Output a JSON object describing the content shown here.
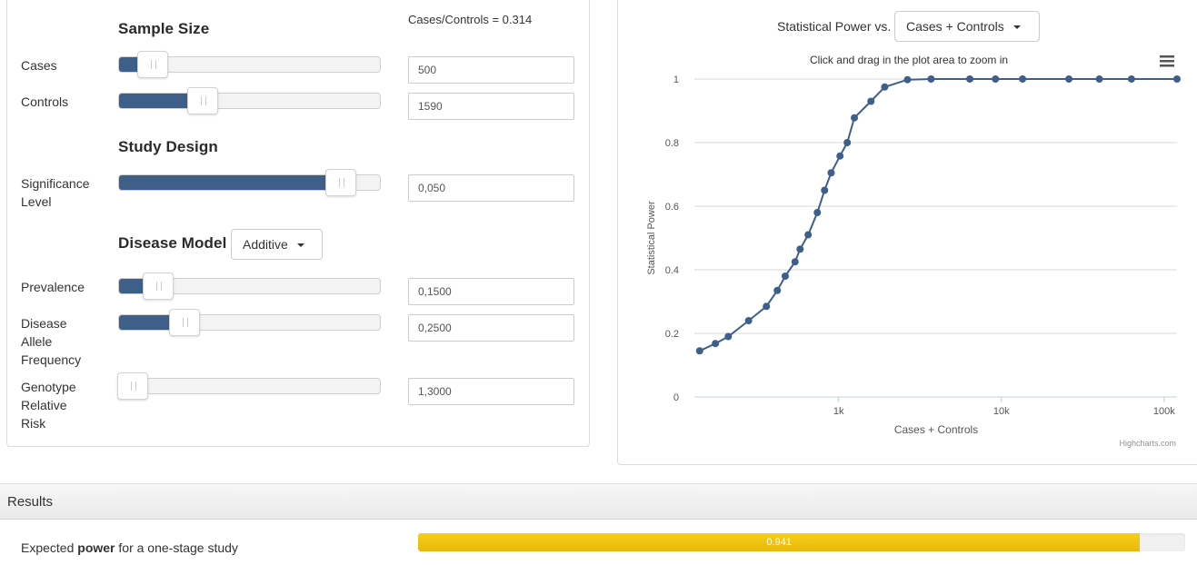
{
  "left": {
    "sample_size": {
      "title": "Sample Size",
      "ratio_text": "Cases/Controls = 0.314",
      "cases": {
        "label": "Cases",
        "value": "500",
        "slider_fraction": 0.13
      },
      "controls": {
        "label": "Controls",
        "value": "1590",
        "slider_fraction": 0.32
      }
    },
    "study_design": {
      "title": "Study Design",
      "significance": {
        "label_line1": "Significance",
        "label_line2": "Level",
        "value": "0,050",
        "slider_fraction": 0.85
      }
    },
    "disease_model": {
      "title": "Disease Model",
      "model_select": "Additive",
      "prevalence": {
        "label": "Prevalence",
        "value": "0,1500",
        "slider_fraction": 0.15
      },
      "allele_frequency": {
        "label_line1": "Disease",
        "label_line2": "Allele",
        "label_line3": "Frequency",
        "value": "0,2500",
        "slider_fraction": 0.25
      },
      "relative_risk": {
        "label_line1": "Genotype",
        "label_line2": "Relative",
        "label_line3": "Risk",
        "value": "1,3000",
        "slider_fraction": 0.02
      }
    }
  },
  "right": {
    "title_prefix": "Statistical Power vs.",
    "x_select": "Cases + Controls",
    "menu_icon": "hamburger-menu-icon",
    "accent_color": "#3e5f8a"
  },
  "chart_data": {
    "type": "line",
    "subtitle": "Click and drag in the plot area to zoom in",
    "xlabel": "Cases + Controls",
    "ylabel": "Statistical Power",
    "x_scale": "log",
    "xlim": [
      130,
      120000
    ],
    "ylim": [
      0,
      1
    ],
    "y_ticks": [
      "0",
      "0.2",
      "0.4",
      "0.6",
      "0.8",
      "1"
    ],
    "x_ticks": [
      "1k",
      "10k",
      "100k"
    ],
    "credits": "Highcharts.com",
    "grid": true,
    "series": [
      {
        "color": "#3e5f8a",
        "x": [
          140,
          175,
          210,
          280,
          360,
          420,
          470,
          540,
          580,
          650,
          740,
          820,
          900,
          1020,
          1130,
          1250,
          1580,
          1920,
          2650,
          3700,
          6400,
          9200,
          13500,
          26000,
          40000,
          63000,
          120000
        ],
        "y": [
          0.145,
          0.168,
          0.19,
          0.24,
          0.285,
          0.335,
          0.38,
          0.425,
          0.465,
          0.51,
          0.58,
          0.65,
          0.705,
          0.758,
          0.8,
          0.878,
          0.93,
          0.975,
          0.998,
          1.0,
          1.0,
          1.0,
          1.0,
          1.0,
          1.0,
          1.0,
          1.0
        ]
      }
    ]
  },
  "results": {
    "header": "Results",
    "text_prefix": "Expected ",
    "text_bold": "power",
    "text_suffix": " for a one-stage study",
    "power_value": "0.941",
    "power_fraction": 0.941,
    "bar_color": "#e8b80a"
  }
}
